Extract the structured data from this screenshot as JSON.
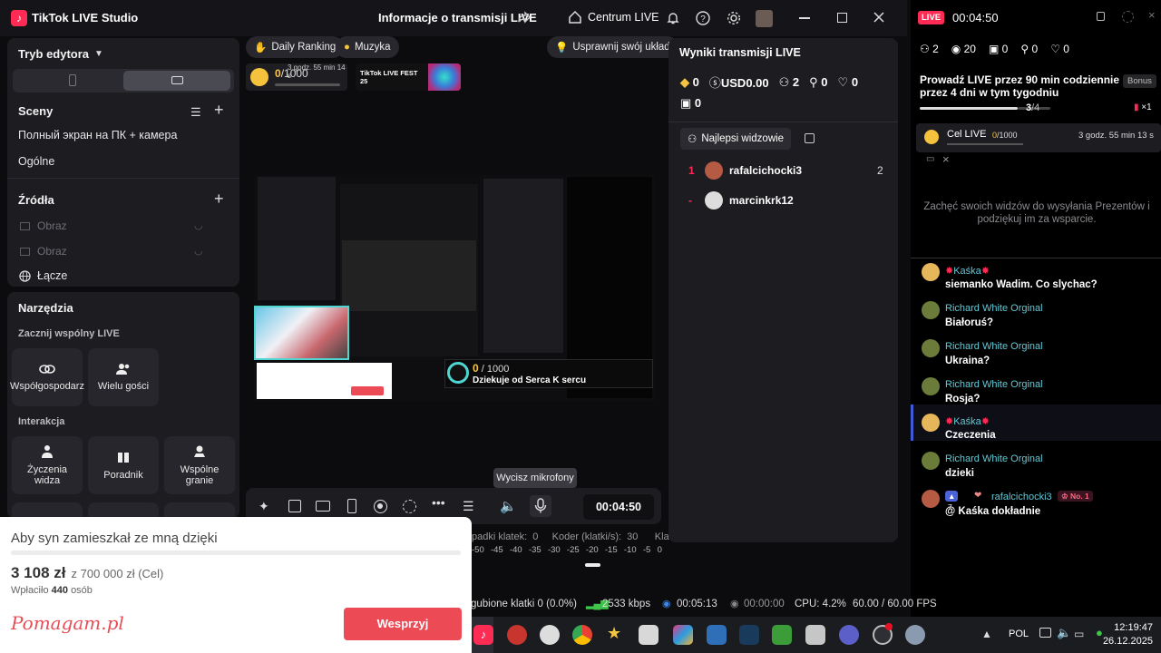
{
  "window": {
    "app_title": "TikTok LIVE Studio",
    "broadcast_title": "Informacje o transmisji LIVE",
    "live_center": "Centrum LIVE"
  },
  "left": {
    "mode_label": "Tryb edytora",
    "scenes_title": "Sceny",
    "scenes": [
      "Полный экран на ПК + камера",
      "Ogólne"
    ],
    "sources_title": "Źródła",
    "sources": [
      "Obraz",
      "Obraz",
      "Łącze"
    ],
    "tools_title": "Narzędzia",
    "coop_title": "Zacznij wspólny LIVE",
    "coop_tools": [
      "Współgospodarz",
      "Wielu gości"
    ],
    "interaction_title": "Interakcja",
    "interaction_tools": [
      "Życzenia widza",
      "Poradnik",
      "Wspólne granie"
    ]
  },
  "center": {
    "chips": [
      "Daily Ranking",
      "Muzyka"
    ],
    "improve_label": "Usprawnij swój układ",
    "goal_value": "0",
    "goal_target": "/1000",
    "goal_time": "3 godz. 55 min 14 s",
    "fest_label": "TikTok LIVE FEST 25",
    "overlay_value": "0",
    "overlay_target": " / 1000",
    "overlay_text": "Dziekuje od Serca K sercu",
    "tooltip": "Wycisz mikrofony",
    "timer": "00:04:50",
    "stats_line": "padki klatek:  0     Koder (klatki/s):  30      Kla",
    "meter_ticks": [
      "-50",
      "-45",
      "-40",
      "-35",
      "-30",
      "-25",
      "-20",
      "-15",
      "-10",
      "-5",
      "0"
    ]
  },
  "results": {
    "title": "Wyniki transmisji LIVE",
    "stats": [
      {
        "icon": "diamond-icon",
        "value": "0"
      },
      {
        "icon": "dollar-icon",
        "value": "USD0.00"
      },
      {
        "icon": "viewers-icon",
        "value": "2"
      },
      {
        "icon": "follow-icon",
        "value": "0"
      },
      {
        "icon": "heart-icon",
        "value": "0"
      }
    ],
    "gift_value": "0",
    "tab_label": "Najlepsi widzowie",
    "viewers": [
      {
        "rank": "1",
        "name": "rafalcichocki3",
        "score": "2"
      },
      {
        "rank": "-",
        "name": "marcinkrk12",
        "score": ""
      }
    ]
  },
  "chat": {
    "live_badge": "LIVE",
    "duration": "00:04:50",
    "counts": [
      "2",
      "20",
      "0",
      "0",
      "0"
    ],
    "challenge": "Prowadź LIVE przez 90 min codziennie przez 4 dni w tym tygodniu",
    "bonus": "Bonus",
    "challenge_progress": "3",
    "challenge_total": "/4",
    "multiplier": "×1",
    "goal_label": "Cel LIVE",
    "goal_value": "0",
    "goal_target": "/1000",
    "goal_time": "3 godz. 55 min 13 s",
    "encourage": "Zachęć swoich widzów do wysyłania Prezentów i podziękuj im za wsparcie.",
    "messages": [
      {
        "name": "Kaśka",
        "text": "siemanko Wadim. Co slychac?"
      },
      {
        "name": "Richard White Orginal",
        "text": "Białoruś?"
      },
      {
        "name": "Richard White Orginal",
        "text": "Ukraina?"
      },
      {
        "name": "Richard White Orginal",
        "text": "Rosja?"
      },
      {
        "name": "Kaśka",
        "text": "Czeczenia"
      },
      {
        "name": "Richard White Orginal",
        "text": "dzieki"
      },
      {
        "name": "rafalcichocki3",
        "text": "@ Kaśka  dokładnie"
      }
    ],
    "badge_level": "7",
    "badge_rank": "No. 1"
  },
  "status": {
    "dropped": "gubione klatki 0 (0.0%)",
    "bitrate": "2533 kbps",
    "rec_time": "00:05:13",
    "stream_time": "00:00:00",
    "cpu": "CPU: 4.2%",
    "fps": "60.00 / 60.00 FPS"
  },
  "popup": {
    "title": "Aby syn zamieszkał ze mną dzięki",
    "raised": "3 108 zł",
    "goal": "z 700 000 zł (Cel)",
    "paid_prefix": "Wpłaciło",
    "paid_count": "440",
    "paid_suffix": "osób",
    "logo": "Pomagam.pl",
    "button": "Wesprzyj"
  },
  "taskbar": {
    "lang": "POL",
    "time": "12:19:47",
    "date": "26.12.2025"
  },
  "colors": {
    "accent": "#fe2c55",
    "teal": "#61c9d6",
    "popup_button": "#ec4a55"
  }
}
